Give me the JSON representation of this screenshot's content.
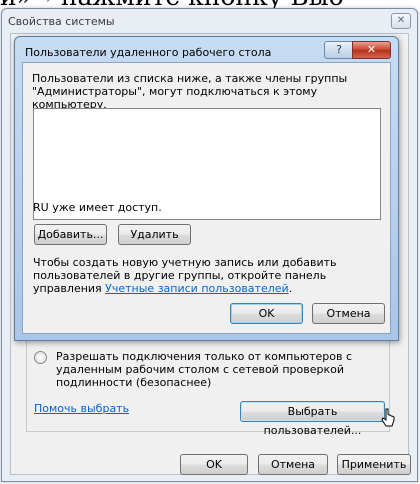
{
  "background_fragment": "и»→ нажмите кнопку Выб",
  "outer": {
    "title": "Свойства системы",
    "close_glyph": "✕",
    "radio_label": "Разрешать подключения только от компьютеров с удаленным рабочим столом с сетевой проверкой подлинности (безопаснее)",
    "help_link": "Помочь выбрать",
    "select_users_button": "Выбрать пользователей...",
    "ok_button": "OK",
    "cancel_button": "Отмена",
    "apply_button": "Применить"
  },
  "inner": {
    "title": "Пользователи удаленного рабочего стола",
    "help_glyph": "?",
    "close_glyph": "✕",
    "description": "Пользователи из списка ниже, а также члены группы \"Администраторы\", могут подключаться к этому компьютеру.",
    "users": [],
    "access_text": "RU уже имеет доступ.",
    "add_button": "Добавить...",
    "remove_button": "Удалить",
    "info_text": "Чтобы создать новую учетную запись или добавить пользователей в другие группы, откройте панель управления ",
    "info_link": "Учетные записи пользователей",
    "info_suffix": ".",
    "ok_button": "OK",
    "cancel_button": "Отмена"
  }
}
